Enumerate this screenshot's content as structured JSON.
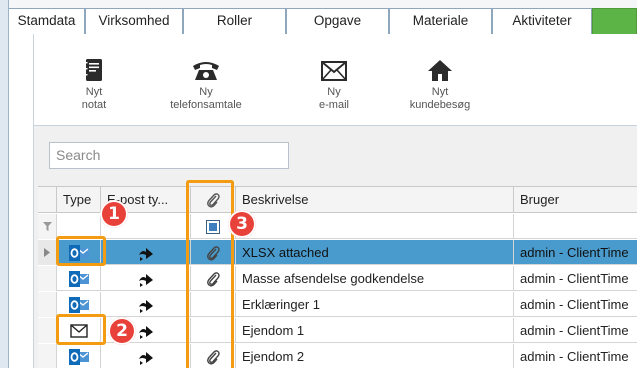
{
  "tabs": [
    "Stamdata",
    "Virksomhed",
    "Roller",
    "Opgave",
    "Materiale",
    "Aktiviteter"
  ],
  "toolbar": {
    "note": {
      "line1": "Nyt",
      "line2": "notat",
      "icon": "notebook-icon"
    },
    "call": {
      "line1": "Ny",
      "line2": "telefonsamtale",
      "icon": "phone-icon"
    },
    "email": {
      "line1": "Ny",
      "line2": "e-mail",
      "icon": "envelope-icon"
    },
    "visit": {
      "line1": "Nyt",
      "line2": "kundebesøg",
      "icon": "house-icon"
    }
  },
  "search": {
    "placeholder": "Search"
  },
  "grid": {
    "columns": {
      "type": "Type",
      "email_type": "E-post ty...",
      "attach": "paperclip",
      "description": "Beskrivelse",
      "user": "Bruger"
    },
    "rows": [
      {
        "type": "outlook",
        "attach": true,
        "description": "XLSX attached",
        "user": "admin - ClientTime",
        "selected": true
      },
      {
        "type": "outlook",
        "attach": true,
        "description": "Masse afsendelse godkendelse",
        "user": "admin - ClientTime",
        "selected": false
      },
      {
        "type": "outlook",
        "attach": false,
        "description": "Erklæringer 1",
        "user": "admin - ClientTime",
        "selected": false
      },
      {
        "type": "mail",
        "attach": false,
        "description": "Ejendom 1",
        "user": "admin - ClientTime",
        "selected": false
      },
      {
        "type": "outlook",
        "attach": true,
        "description": "Ejendom 2",
        "user": "admin - ClientTime",
        "selected": false
      }
    ]
  },
  "annotations": [
    "1",
    "2",
    "3"
  ],
  "colors": {
    "highlight": "#f39c12",
    "badge": "#e8413a",
    "selected_row": "#4a9bcd",
    "active_tab": "#5bb445"
  }
}
